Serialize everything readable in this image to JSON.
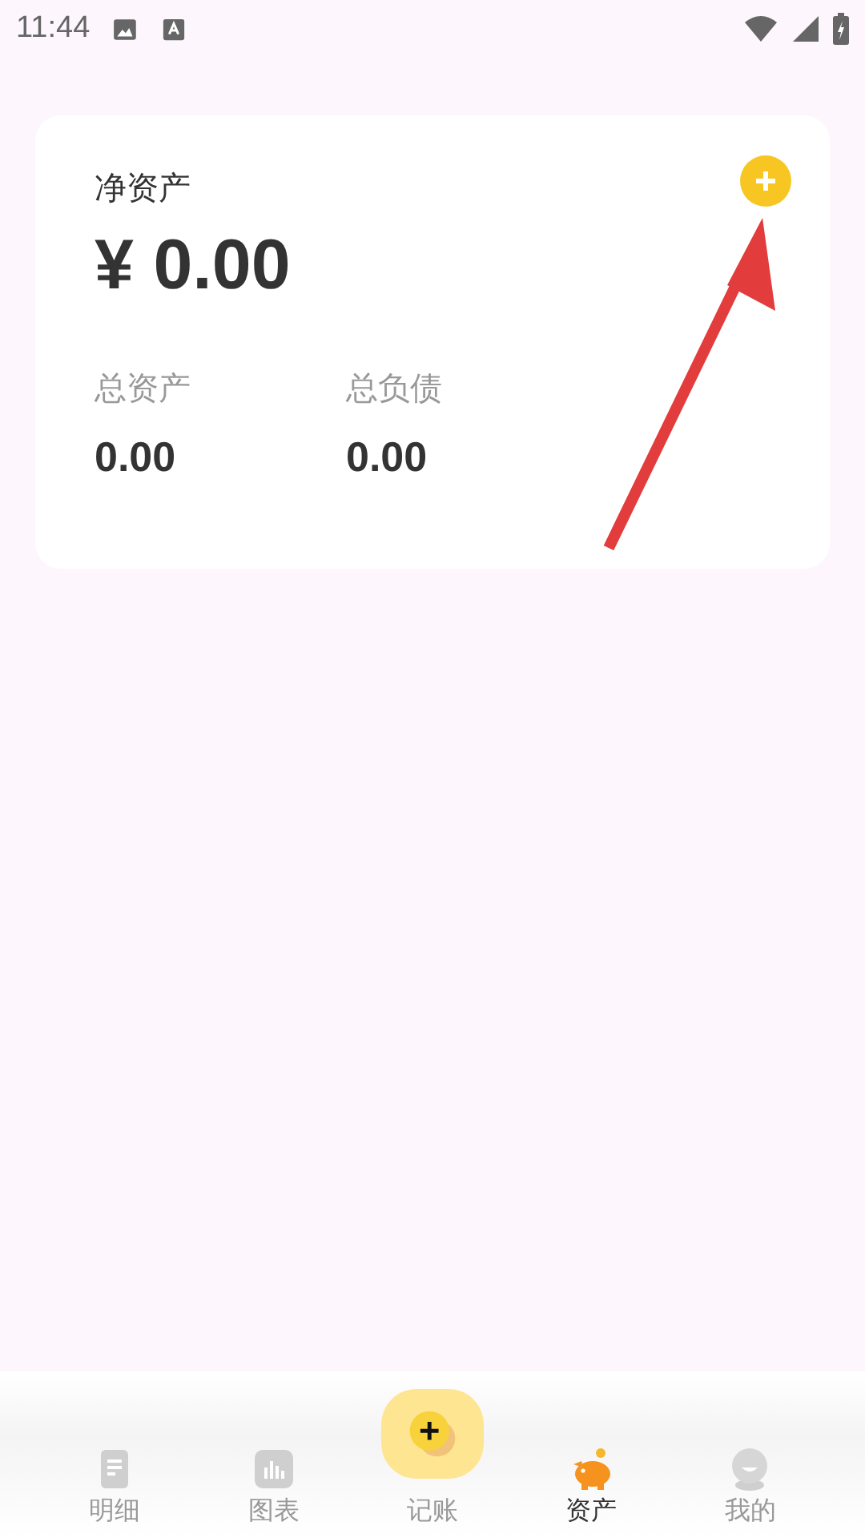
{
  "status_bar": {
    "time": "11:44"
  },
  "summary_card": {
    "title": "净资产",
    "net_value": "¥ 0.00",
    "stats": [
      {
        "label": "总资产",
        "value": "0.00"
      },
      {
        "label": "总负债",
        "value": "0.00"
      }
    ]
  },
  "bottom_nav": [
    {
      "label": "明细",
      "kind": "list",
      "selected": false
    },
    {
      "label": "图表",
      "kind": "chart",
      "selected": false
    },
    {
      "label": "记账",
      "kind": "add",
      "selected": false
    },
    {
      "label": "资产",
      "kind": "piggy",
      "selected": true
    },
    {
      "label": "我的",
      "kind": "user",
      "selected": false
    }
  ]
}
